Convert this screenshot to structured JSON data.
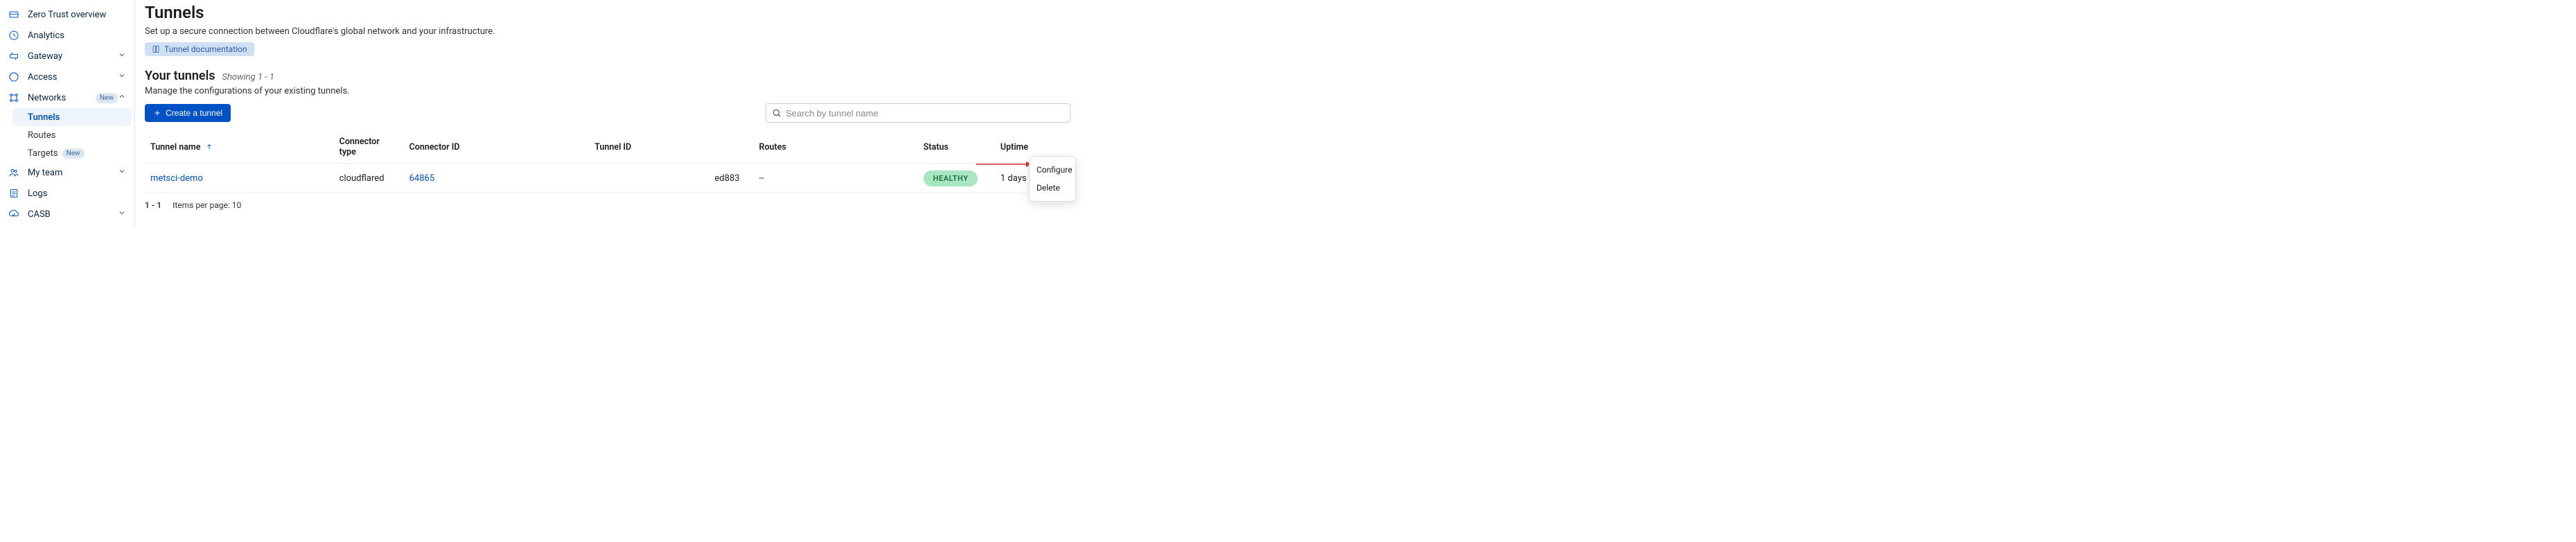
{
  "sidebar": {
    "items": [
      {
        "id": "overview",
        "label": "Zero Trust overview",
        "icon": "card"
      },
      {
        "id": "analytics",
        "label": "Analytics",
        "icon": "clock"
      },
      {
        "id": "gateway",
        "label": "Gateway",
        "icon": "gateway",
        "expandable": true
      },
      {
        "id": "access",
        "label": "Access",
        "icon": "access",
        "expandable": true
      },
      {
        "id": "networks",
        "label": "Networks",
        "icon": "networks",
        "badge": "New",
        "expanded": true
      },
      {
        "id": "myteam",
        "label": "My team",
        "icon": "team",
        "expandable": true
      },
      {
        "id": "logs",
        "label": "Logs",
        "icon": "logs"
      },
      {
        "id": "casb",
        "label": "CASB",
        "icon": "casb",
        "expandable": true
      }
    ],
    "networks_sub": [
      {
        "id": "tunnels",
        "label": "Tunnels",
        "active": true
      },
      {
        "id": "routes",
        "label": "Routes"
      },
      {
        "id": "targets",
        "label": "Targets",
        "badge": "New"
      }
    ],
    "new_badge": "New"
  },
  "header": {
    "title": "Tunnels",
    "subtitle": "Set up a secure connection between Cloudflare's global network and your infrastructure.",
    "doc_link": "Tunnel documentation"
  },
  "section": {
    "title": "Your tunnels",
    "showing": "Showing 1 - 1",
    "desc": "Manage the configurations of your existing tunnels.",
    "create_btn": "Create a tunnel",
    "search_placeholder": "Search by tunnel name"
  },
  "table": {
    "columns": {
      "name": "Tunnel name",
      "conn_type": "Connector type",
      "conn_id": "Connector ID",
      "tunnel_id": "Tunnel ID",
      "routes": "Routes",
      "status": "Status",
      "uptime": "Uptime"
    },
    "rows": [
      {
        "name": "metsci-demo",
        "conn_type": "cloudflared",
        "conn_id": "64865",
        "tunnel_id": "ed883",
        "routes": "--",
        "status": "HEALTHY",
        "uptime": "1 days"
      }
    ]
  },
  "footer": {
    "range": "1 - 1",
    "per_page_label": "Items per page: 10"
  },
  "dropdown": {
    "items": [
      {
        "id": "configure",
        "label": "Configure"
      },
      {
        "id": "delete",
        "label": "Delete"
      }
    ]
  }
}
